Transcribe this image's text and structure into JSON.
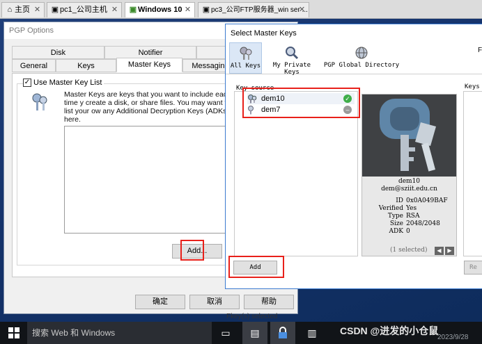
{
  "vm_tabs": [
    {
      "label": "主页",
      "icon": "home-icon"
    },
    {
      "label": "pc1_公司主机",
      "icon": "vm-icon"
    },
    {
      "label": "Windows 10",
      "icon": "vm-icon"
    },
    {
      "label": "pc3_公司FTP服务器_win ser ...",
      "icon": "vm-icon"
    }
  ],
  "pgp_options": {
    "title": "PGP Options",
    "tabs_row1": [
      "Disk",
      "Notifier",
      ""
    ],
    "tabs_row2": [
      "General",
      "Keys",
      "Master Keys",
      "Messaging"
    ],
    "use_master_key_list_label": "Use Master Key List",
    "use_master_key_list_checked": true,
    "description": "Master Keys are keys that you want to include each time y create a disk, or share files.  You may want to list your ow any Additional Decryption Keys (ADKs) here.",
    "add_button": "Add...",
    "ok_button": "确定",
    "cancel_button": "取消",
    "help_button": "帮助",
    "status_fragment": "Fkey(s) selected"
  },
  "select_master_keys": {
    "title": "Select Master Keys",
    "toolbar": [
      {
        "label": "All Keys",
        "icon": "keys-icon",
        "selected": true
      },
      {
        "label": "My Private Keys",
        "icon": "search-key-icon",
        "selected": false
      },
      {
        "label": "PGP Global Directory",
        "icon": "globe-key-icon",
        "selected": false
      }
    ],
    "toolbar_cut_label": "F",
    "key_source_label": "Key source",
    "keys_label_right": "Keys",
    "key_source_items": [
      {
        "name": "dem10",
        "status": "valid",
        "icon": "key-pair-icon"
      },
      {
        "name": "dem7",
        "status": "disabled",
        "icon": "key-icon"
      }
    ],
    "detail": {
      "name": "dem10",
      "email": "dem@sziit.edu.cn",
      "fields": [
        {
          "k": "ID",
          "v": "0x0A049BAF"
        },
        {
          "k": "Verified",
          "v": "Yes"
        },
        {
          "k": "Type",
          "v": "RSA"
        },
        {
          "k": "Size",
          "v": "2048/2048"
        },
        {
          "k": "ADK",
          "v": "0"
        }
      ],
      "selected_count": "(1 selected)"
    },
    "add_button": "Add",
    "remove_button_cut": "Re"
  },
  "taskbar": {
    "search_placeholder": "搜索 Web 和 Windows",
    "watermark": "CSDN @进发的小仓鼠",
    "date": "2023/9/28"
  },
  "colors": {
    "highlight": "#e8201a",
    "valid": "#3fae49",
    "disabled": "#9a9a9a",
    "titlebar_accent": "#3b7bd0"
  }
}
